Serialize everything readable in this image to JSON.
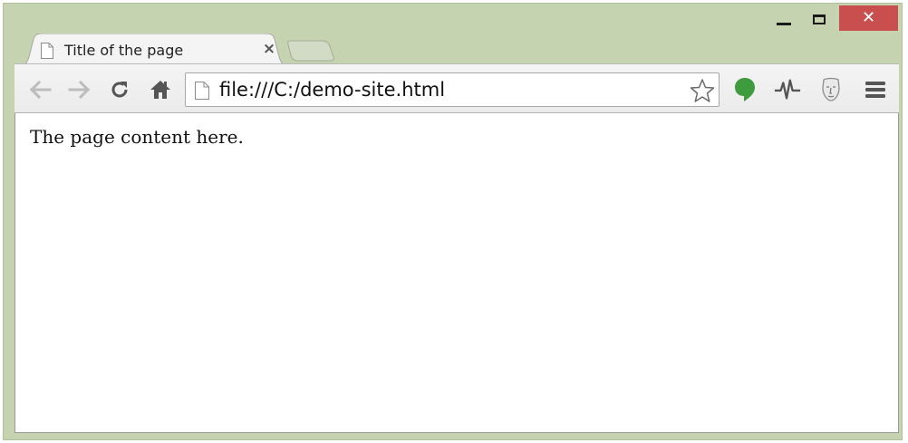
{
  "window": {
    "controls": [
      "minimize",
      "maximize",
      "close"
    ],
    "close_color": "#c94f4f",
    "frame_color": "#c5d3b1"
  },
  "tabs": [
    {
      "title": "Title of the page",
      "icon": "page-icon",
      "close_label": "×"
    }
  ],
  "toolbar": {
    "buttons": [
      "back-icon",
      "forward-icon",
      "reload-icon",
      "home-icon"
    ],
    "url": "file:///C:/demo-site.html",
    "extensions": [
      "hangouts-icon",
      "pulse-icon",
      "mask-icon"
    ],
    "menu_icon": "menu-icon",
    "accent_green": "#3e9b3e"
  },
  "page": {
    "content": "The page content here."
  }
}
